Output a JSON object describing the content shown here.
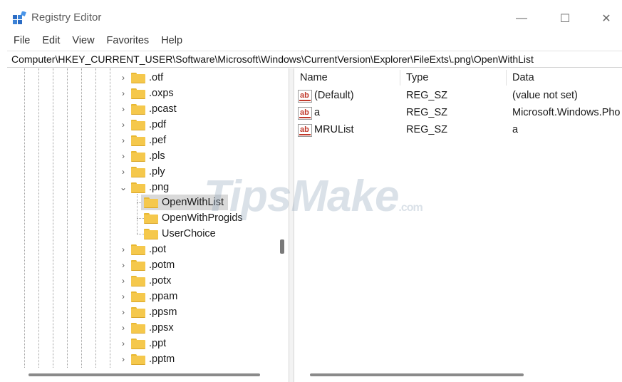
{
  "window": {
    "title": "Registry Editor",
    "controls": {
      "minimize": "—",
      "maximize": "☐",
      "close": "✕"
    }
  },
  "menu": [
    "File",
    "Edit",
    "View",
    "Favorites",
    "Help"
  ],
  "address": "Computer\\HKEY_CURRENT_USER\\Software\\Microsoft\\Windows\\CurrentVersion\\Explorer\\FileExts\\.png\\OpenWithList",
  "tree": {
    "items_before": [
      ".otf",
      ".oxps",
      ".pcast",
      ".pdf",
      ".pef",
      ".pls",
      ".ply"
    ],
    "expanded": ".png",
    "children": [
      "OpenWithList",
      "OpenWithProgids",
      "UserChoice"
    ],
    "selected_child": "OpenWithList",
    "items_after": [
      ".pot",
      ".potm",
      ".potx",
      ".ppam",
      ".ppsm",
      ".ppsx",
      ".ppt",
      ".pptm"
    ]
  },
  "list": {
    "columns": [
      "Name",
      "Type",
      "Data"
    ],
    "rows": [
      {
        "name": "(Default)",
        "type": "REG_SZ",
        "data": "(value not set)",
        "icon": "string-value-icon"
      },
      {
        "name": "a",
        "type": "REG_SZ",
        "data": "Microsoft.Windows.Pho",
        "icon": "string-value-icon"
      },
      {
        "name": "MRUList",
        "type": "REG_SZ",
        "data": "a",
        "icon": "string-value-icon"
      }
    ]
  },
  "watermark": {
    "main": "TipsMake",
    "suffix": ".com"
  },
  "colors": {
    "folder": "#f5c84c",
    "selection": "#d9d9d9",
    "string_icon": "#c0392b"
  }
}
